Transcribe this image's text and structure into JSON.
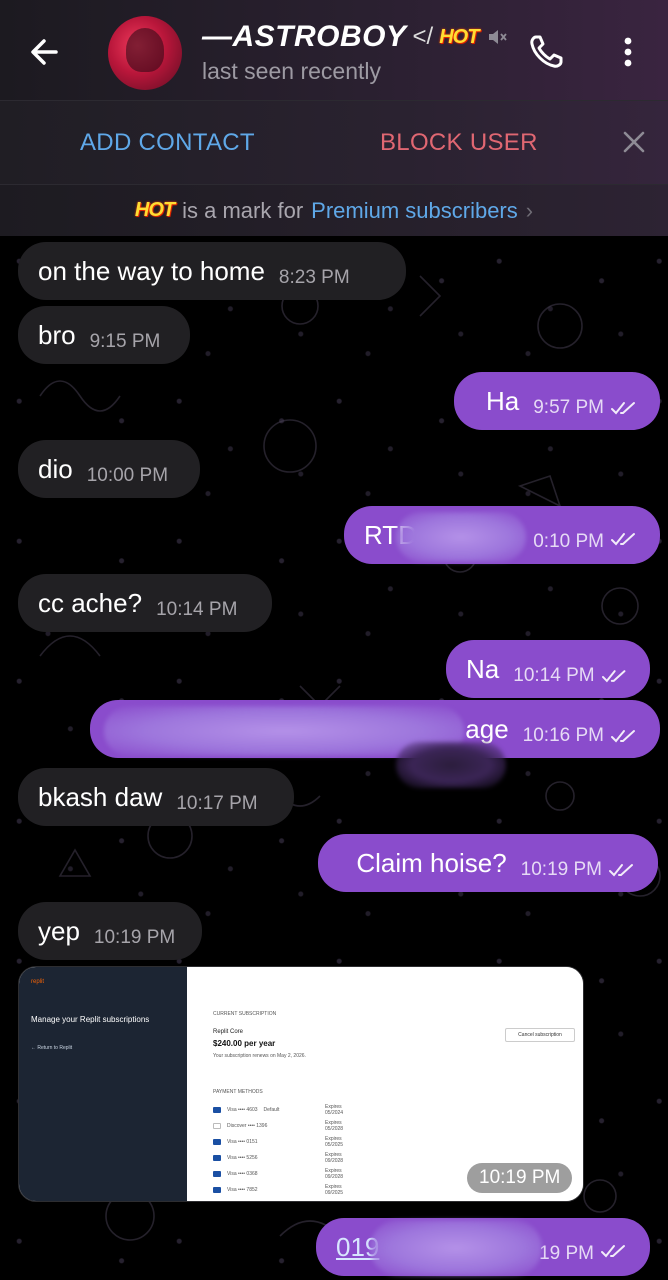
{
  "header": {
    "contact_name": "—ASTROBOY",
    "name_suffix": "</",
    "hot_badge": "HOT",
    "status": "last seen recently"
  },
  "action_bar": {
    "add_contact": "ADD CONTACT",
    "block_user": "BLOCK USER"
  },
  "premium_notice": {
    "badge": "HOT",
    "text": "is a mark for",
    "link": "Premium subscribers"
  },
  "messages": [
    {
      "direction": "in",
      "text": "on the way to home",
      "time": "8:23 PM"
    },
    {
      "direction": "in",
      "text": "bro",
      "time": "9:15 PM"
    },
    {
      "direction": "out",
      "text": "Ha",
      "time": "9:57 PM",
      "read": true
    },
    {
      "direction": "in",
      "text": "dio",
      "time": "10:00 PM"
    },
    {
      "direction": "out",
      "text": "RTD",
      "time": "0:10 PM",
      "read": true,
      "redacted": true
    },
    {
      "direction": "in",
      "text": "cc ache?",
      "time": "10:14 PM"
    },
    {
      "direction": "out",
      "text": "Na",
      "time": "10:14 PM",
      "read": true
    },
    {
      "direction": "out",
      "text": "age",
      "time": "10:16 PM",
      "read": true,
      "redacted": true
    },
    {
      "direction": "in",
      "text": "bkash daw",
      "time": "10:17 PM"
    },
    {
      "direction": "out",
      "text": "Claim hoise?",
      "time": "10:19 PM",
      "read": true
    },
    {
      "direction": "in",
      "text": "yep",
      "time": "10:19 PM"
    },
    {
      "direction": "out",
      "text": "019",
      "time": "19 PM",
      "read": true,
      "redacted": true
    }
  ],
  "image_message": {
    "time": "10:19 PM",
    "screenshot": {
      "logo": "replit",
      "heading": "Manage your Replit subscriptions",
      "return_link": "← Return to Replit",
      "current_subscription_label": "CURRENT SUBSCRIPTION",
      "plan": "Replit Core",
      "price": "$240.00 per year",
      "renewal": "Your subscription renews on May 2, 2026.",
      "cancel_button": "Cancel subscription",
      "payment_methods_label": "PAYMENT METHODS",
      "payment_methods": [
        {
          "card": "Visa •••• 4603",
          "tag": "Default",
          "expires": "Expires 05/2024"
        },
        {
          "card": "Discover •••• 1396",
          "tag": "",
          "expires": "Expires 05/2028"
        },
        {
          "card": "Visa •••• 0151",
          "tag": "",
          "expires": "Expires 05/2025"
        },
        {
          "card": "Visa •••• 5256",
          "tag": "",
          "expires": "Expires 09/2028"
        },
        {
          "card": "Visa •••• 0368",
          "tag": "",
          "expires": "Expires 09/2028"
        },
        {
          "card": "Visa •••• 7852",
          "tag": "",
          "expires": "Expires 09/2025"
        }
      ]
    }
  },
  "colors": {
    "outgoing_bubble": "#8a4ccc",
    "incoming_bubble": "#212023",
    "link_blue": "#5fa8e8",
    "block_red": "#e06772"
  },
  "icons": {
    "back": "arrow-left-icon",
    "mute": "speaker-muted-icon",
    "call": "phone-icon",
    "menu": "vertical-dots-icon",
    "close": "close-icon",
    "read": "double-check-icon"
  }
}
